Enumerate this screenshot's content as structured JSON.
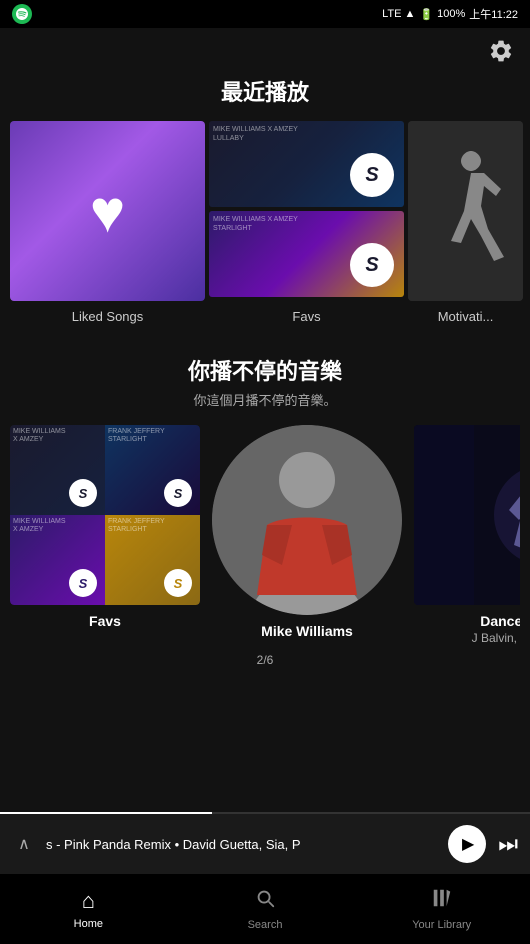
{
  "statusBar": {
    "carrier": "",
    "network": "LTE",
    "battery": "100%",
    "time": "上午11:22"
  },
  "header": {
    "gearLabel": "⚙"
  },
  "recentSection": {
    "title": "最近播放",
    "items": [
      {
        "id": "liked-songs",
        "label": "Liked Songs"
      },
      {
        "id": "favs",
        "label": "Favs"
      },
      {
        "id": "motivation",
        "label": "Motivati..."
      }
    ]
  },
  "playSection": {
    "title": "你播不停的音樂",
    "subtitle": "你這個月播不停的音樂。",
    "items": [
      {
        "id": "favs2",
        "label": "Favs",
        "sub": ""
      },
      {
        "id": "mike",
        "label": "Mike Williams",
        "sub": ""
      },
      {
        "id": "dance",
        "label": "Dance ...",
        "sub": "J Balvin, DJ S"
      }
    ]
  },
  "nowPlaying": {
    "track": "s - Pink Panda Remix • David Guetta, Sia, P",
    "expandIcon": "∧",
    "playIcon": "▶",
    "skipIcon": "⏭"
  },
  "pagination": {
    "text": "2/6"
  },
  "bottomNav": {
    "items": [
      {
        "id": "home",
        "icon": "⌂",
        "label": "Home",
        "active": true
      },
      {
        "id": "search",
        "icon": "🔍",
        "label": "Search",
        "active": false
      },
      {
        "id": "library",
        "icon": "▤",
        "label": "Your Library",
        "active": false
      }
    ]
  }
}
